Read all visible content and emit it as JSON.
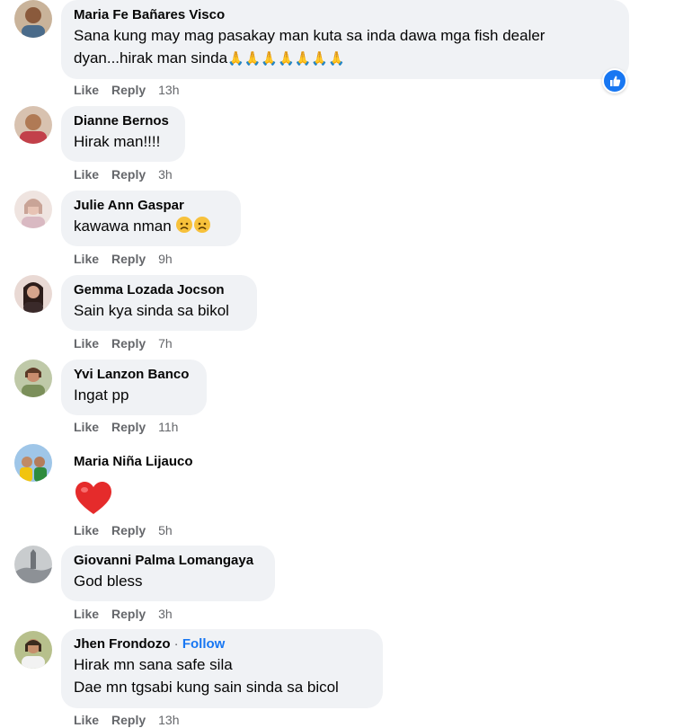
{
  "comments": [
    {
      "author": "Maria Fe Bañares Visco",
      "lines": [
        "Sana kung may mag pasakay man kuta sa inda dawa mga fish dealer",
        "dyan...hirak man sinda"
      ],
      "emoji": "🙏🙏🙏🙏🙏🙏🙏",
      "like": "Like",
      "reply": "Reply",
      "time": "13h"
    },
    {
      "author": "Dianne Bernos",
      "lines": [
        "Hirak man!!!!"
      ],
      "like": "Like",
      "reply": "Reply",
      "time": "3h"
    },
    {
      "author": "Julie Ann Gaspar",
      "lines": [
        "kawawa nman"
      ],
      "like": "Like",
      "reply": "Reply",
      "time": "9h"
    },
    {
      "author": "Gemma Lozada Jocson",
      "lines": [
        "Sain kya sinda sa bikol"
      ],
      "like": "Like",
      "reply": "Reply",
      "time": "7h"
    },
    {
      "author": "Yvi Lanzon Banco",
      "lines": [
        "Ingat pp"
      ],
      "like": "Like",
      "reply": "Reply",
      "time": "11h"
    },
    {
      "author": "Maria Niña Lijauco",
      "lines": [],
      "like": "Like",
      "reply": "Reply",
      "time": "5h"
    },
    {
      "author": "Giovanni Palma Lomangaya",
      "lines": [
        "God bless"
      ],
      "like": "Like",
      "reply": "Reply",
      "time": "3h"
    },
    {
      "author": "Jhen Frondozo",
      "follow_sep": "·",
      "follow": "Follow",
      "lines": [
        "Hirak mn sana safe sila",
        "Dae mn tgsabi kung sain sinda sa bicol"
      ],
      "like": "Like",
      "reply": "Reply",
      "time": "13h"
    }
  ],
  "colors": {
    "bubble": "#f0f2f5",
    "meta": "#65676b",
    "accent": "#1877f2"
  }
}
